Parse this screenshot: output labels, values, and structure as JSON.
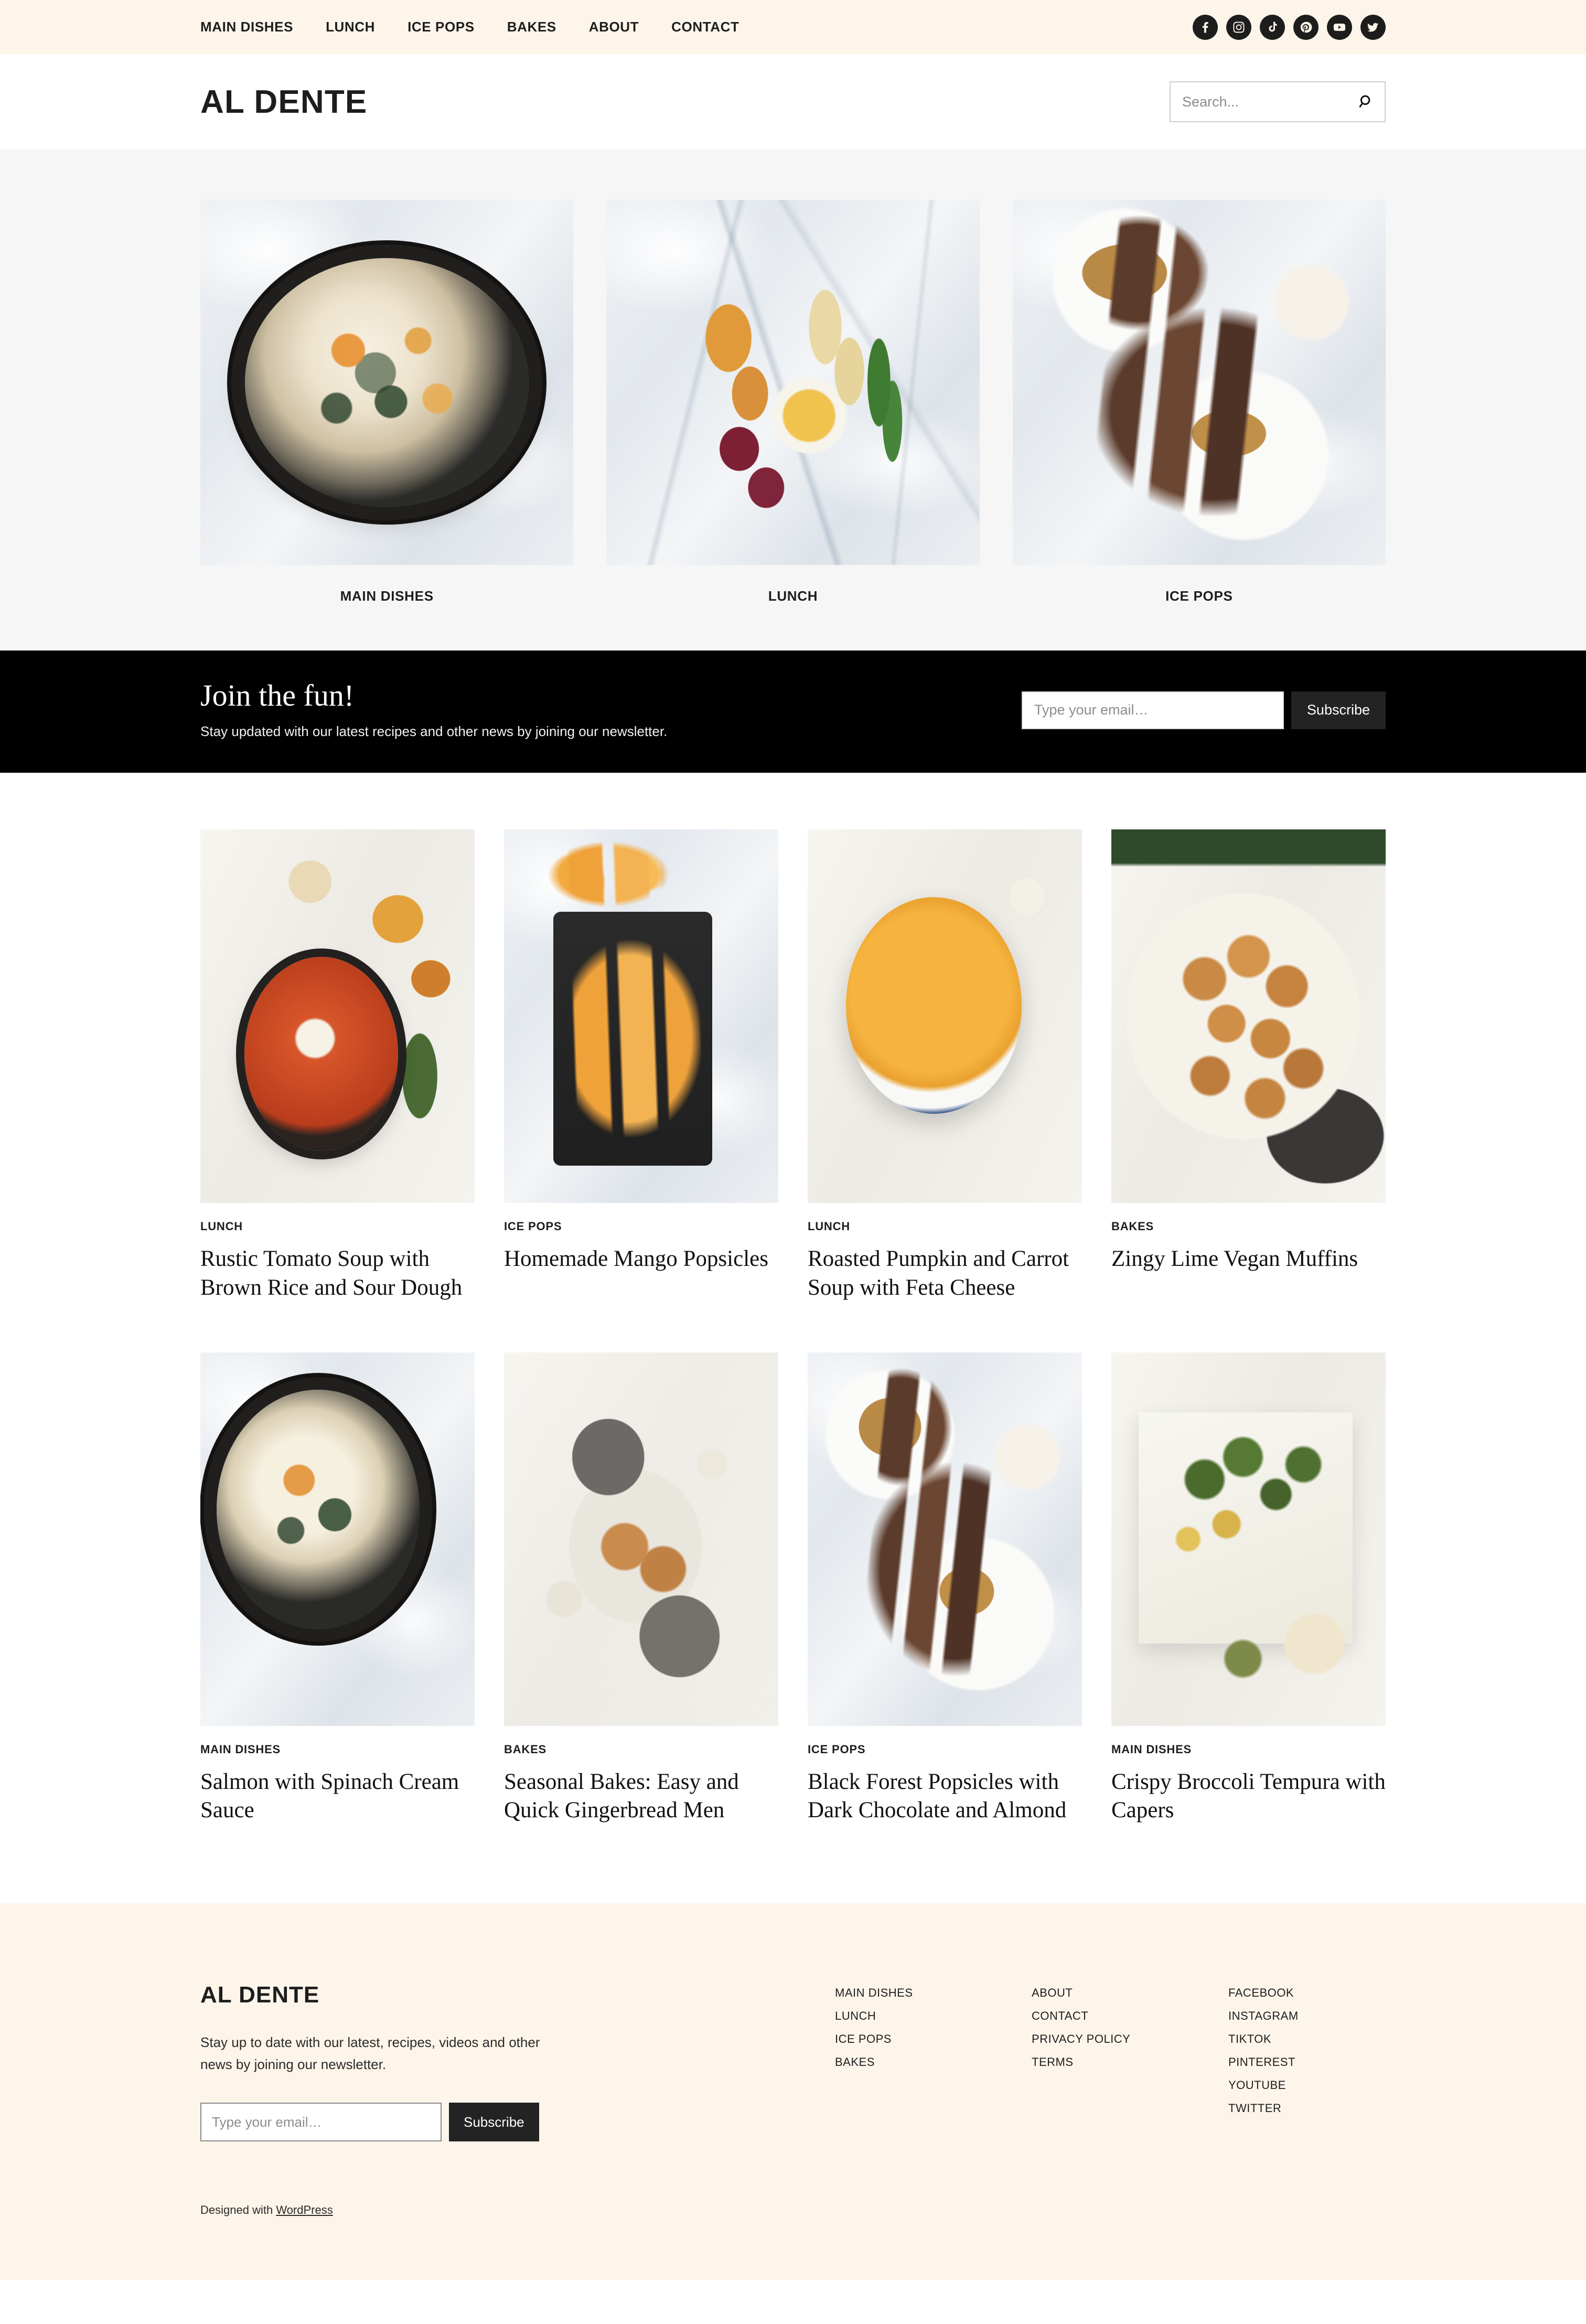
{
  "site": {
    "brand": "AL DENTE",
    "footer_brand": "AL DENTE"
  },
  "topnav": {
    "items": [
      {
        "label": "MAIN DISHES"
      },
      {
        "label": "LUNCH"
      },
      {
        "label": "ICE POPS"
      },
      {
        "label": "BAKES"
      },
      {
        "label": "ABOUT"
      },
      {
        "label": "CONTACT"
      }
    ],
    "socials": [
      {
        "name": "facebook-icon",
        "label": "Facebook"
      },
      {
        "name": "instagram-icon",
        "label": "Instagram"
      },
      {
        "name": "tiktok-icon",
        "label": "TikTok"
      },
      {
        "name": "pinterest-icon",
        "label": "Pinterest"
      },
      {
        "name": "youtube-icon",
        "label": "YouTube"
      },
      {
        "name": "twitter-icon",
        "label": "Twitter"
      }
    ]
  },
  "search": {
    "placeholder": "Search...",
    "value": ""
  },
  "hero": {
    "categories": [
      {
        "label": "MAIN DISHES",
        "art": "marble skillet"
      },
      {
        "label": "LUNCH",
        "art": "marble platter"
      },
      {
        "label": "ICE POPS",
        "art": "marble popsicle"
      }
    ]
  },
  "newsletter": {
    "title": "Join the fun!",
    "subtitle": "Stay updated with our latest recipes and other news by joining our newsletter.",
    "email_placeholder": "Type your email…",
    "email_value": "",
    "button_label": "Subscribe"
  },
  "posts": [
    {
      "category": "LUNCH",
      "title": "Rustic Tomato Soup with Brown Rice and Sour Dough",
      "art": "linen tomato"
    },
    {
      "category": "ICE POPS",
      "title": "Homemade Mango Popsicles",
      "art": "marble mango"
    },
    {
      "category": "LUNCH",
      "title": "Roasted Pumpkin and Carrot Soup with Feta Cheese",
      "art": "linen pumpkin"
    },
    {
      "category": "BAKES",
      "title": "Zingy Lime Vegan Muffins",
      "art": "linen muffins"
    },
    {
      "category": "MAIN DISHES",
      "title": "Salmon with Spinach Cream Sauce",
      "art": "marble salmon2"
    },
    {
      "category": "BAKES",
      "title": "Seasonal Bakes: Easy and Quick Gingerbread Men",
      "art": "linen gingerbread"
    },
    {
      "category": "ICE POPS",
      "title": "Black Forest Popsicles with Dark Chocolate and Almond",
      "art": "marble popsicle"
    },
    {
      "category": "MAIN DISHES",
      "title": "Crispy Broccoli Tempura with Capers",
      "art": "linen broccoli"
    }
  ],
  "footer": {
    "description": "Stay up to date with our latest, recipes, videos and other news by joining our newsletter.",
    "email_placeholder": "Type your email…",
    "email_value": "",
    "button_label": "Subscribe",
    "credit_prefix": "Designed with ",
    "credit_link": "WordPress",
    "columns": [
      {
        "items": [
          {
            "label": "MAIN DISHES"
          },
          {
            "label": "LUNCH"
          },
          {
            "label": "ICE POPS"
          },
          {
            "label": "BAKES"
          }
        ]
      },
      {
        "items": [
          {
            "label": "ABOUT"
          },
          {
            "label": "CONTACT"
          },
          {
            "label": "PRIVACY POLICY"
          },
          {
            "label": "TERMS"
          }
        ]
      },
      {
        "items": [
          {
            "label": "FACEBOOK"
          },
          {
            "label": "INSTAGRAM"
          },
          {
            "label": "TIKTOK"
          },
          {
            "label": "PINTEREST"
          },
          {
            "label": "YOUTUBE"
          },
          {
            "label": "TWITTER"
          }
        ]
      }
    ]
  },
  "colors": {
    "cream": "#fdf5ea",
    "hero_bg": "#f6f6f6",
    "ink": "#1d1d1d",
    "band": "#000000",
    "button": "#232323"
  }
}
